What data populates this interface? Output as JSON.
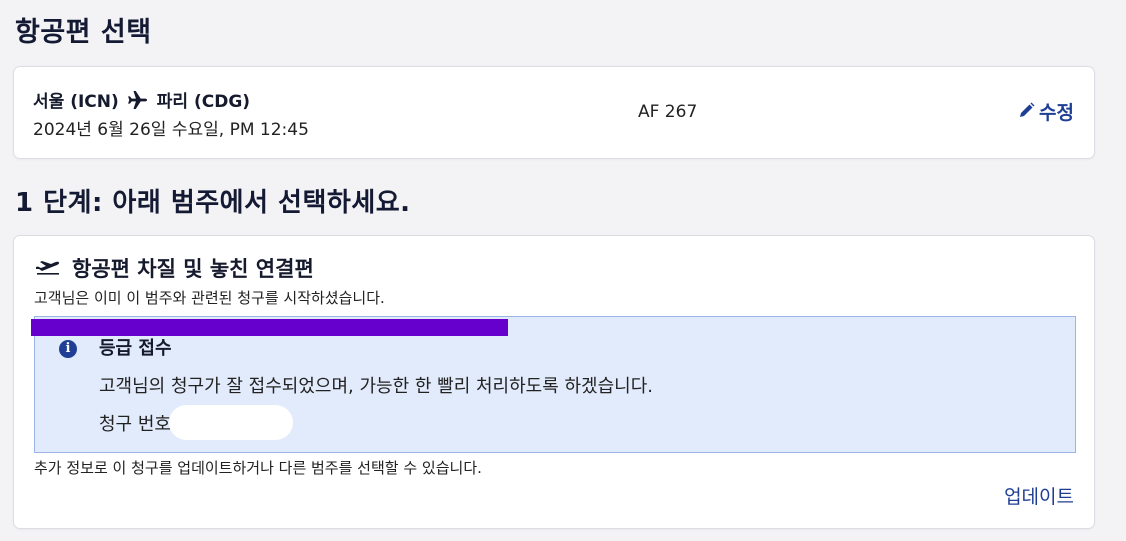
{
  "page": {
    "title": "항공편 선택"
  },
  "flight": {
    "origin": "서울 (ICN)",
    "destination": "파리 (CDG)",
    "datetime": "2024년 6월 26일 수요일, PM 12:45",
    "flight_number": "AF 267",
    "edit_label": "수정",
    "route_icon": "plane-icon",
    "edit_icon": "pencil-icon"
  },
  "step": {
    "title": "1 단계: 아래 범주에서 선택하세요."
  },
  "claim": {
    "category_icon": "plane-takeoff-icon",
    "category_title": "항공편 차질 및 놓친 연결편",
    "description": "고객님은 이미 이 범주와 관련된 청구를 시작하셨습니다.",
    "notice": {
      "icon": "info-icon",
      "title": "등급 접수",
      "message": "고객님의 청구가 잘 접수되었으며, 가능한 한 빨리 처리하도록 하겠습니다.",
      "claim_number_label": "청구 번호"
    },
    "update_note": "추가 정보로 이 청구를 업데이트하거나 다른 범주를 선택할 수 있습니다.",
    "update_label": "업데이트"
  },
  "colors": {
    "accent": "#1f3f95",
    "notice_bg": "#e2ebfb",
    "notice_border": "#9cb4e6",
    "redaction": "#6600cc"
  }
}
